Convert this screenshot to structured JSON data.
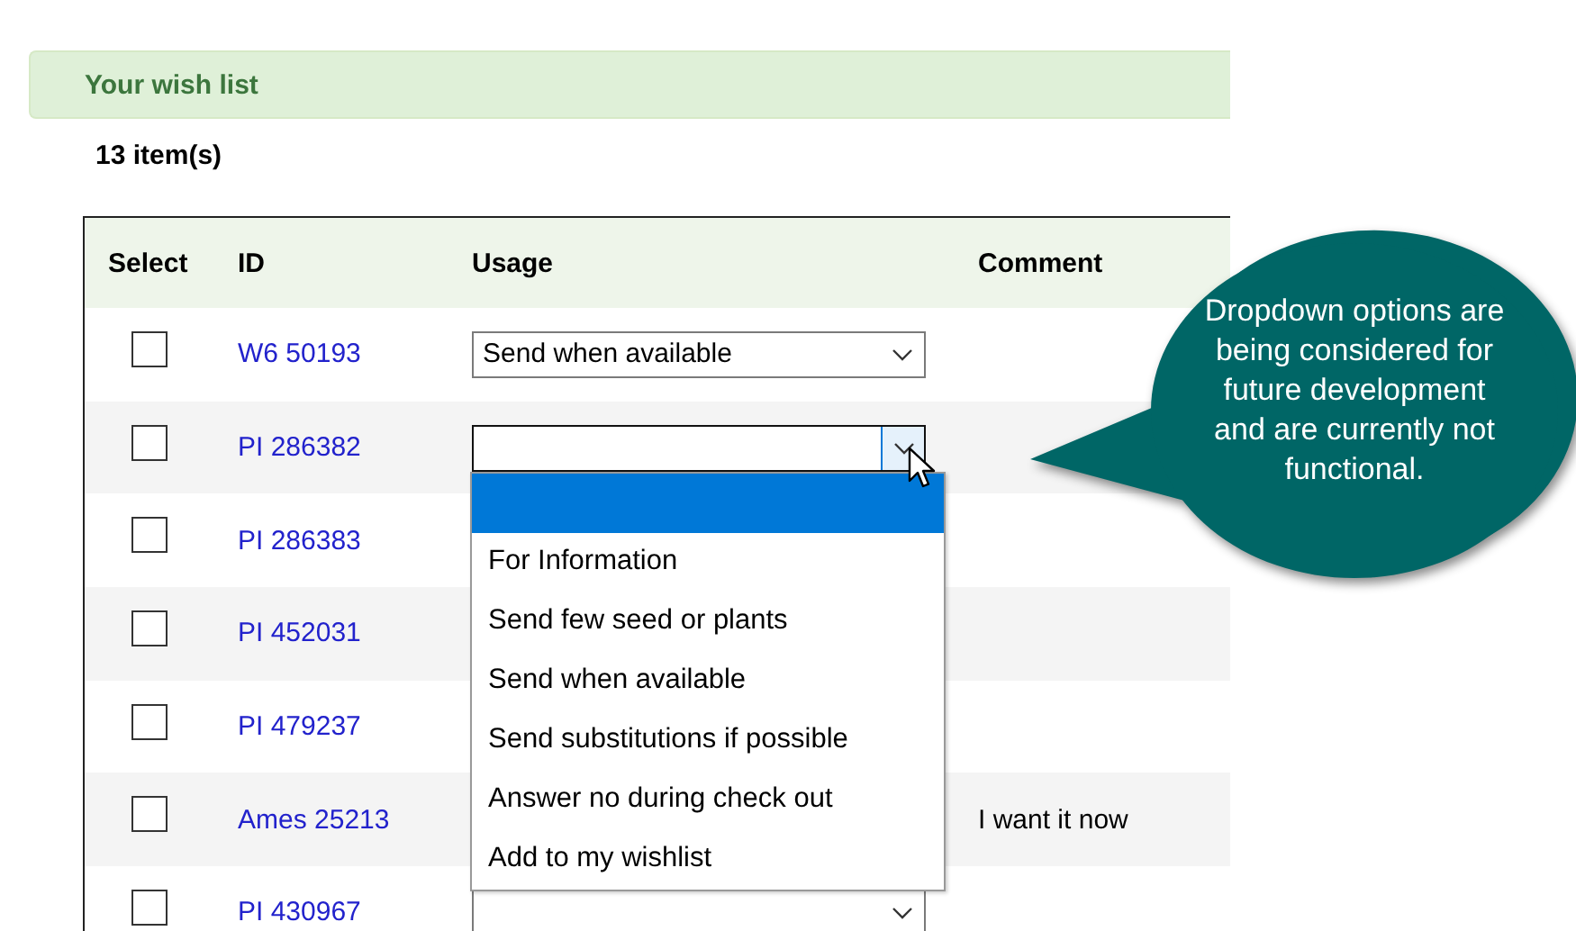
{
  "header": {
    "title": "Your wish list"
  },
  "item_count": "13 item(s)",
  "table": {
    "columns": [
      "Select",
      "ID",
      "Usage",
      "Comment"
    ],
    "rows": [
      {
        "checked": false,
        "id": "W6 50193",
        "usage": "Send when available",
        "usage_open": false
      },
      {
        "checked": false,
        "id": "PI 286382",
        "usage_open": true
      },
      {
        "checked": false,
        "id": "PI 286383",
        "usage_open": false
      },
      {
        "checked": false,
        "id": "PI 452031",
        "usage_open": false
      },
      {
        "checked": false,
        "id": "PI 479237",
        "usage_open": false
      },
      {
        "checked": false,
        "id": "Ames 25213",
        "usage_open": false,
        "comment": "I want it now"
      },
      {
        "checked": false,
        "id": "PI 430967",
        "usage_open": false
      }
    ]
  },
  "dropdown": {
    "options": [
      {
        "selected": true
      },
      {
        "label": "For Information",
        "selected": false
      },
      {
        "label": "Send few seed or plants",
        "selected": false
      },
      {
        "label": "Send when available",
        "selected": false
      },
      {
        "label": "Send substitutions if possible",
        "selected": false
      },
      {
        "label": "Answer no during check out",
        "selected": false
      },
      {
        "label": "Add to my wishlist",
        "selected": false
      }
    ]
  },
  "callout": {
    "text": "Dropdown options are being considered for future development and are currently not functional."
  }
}
